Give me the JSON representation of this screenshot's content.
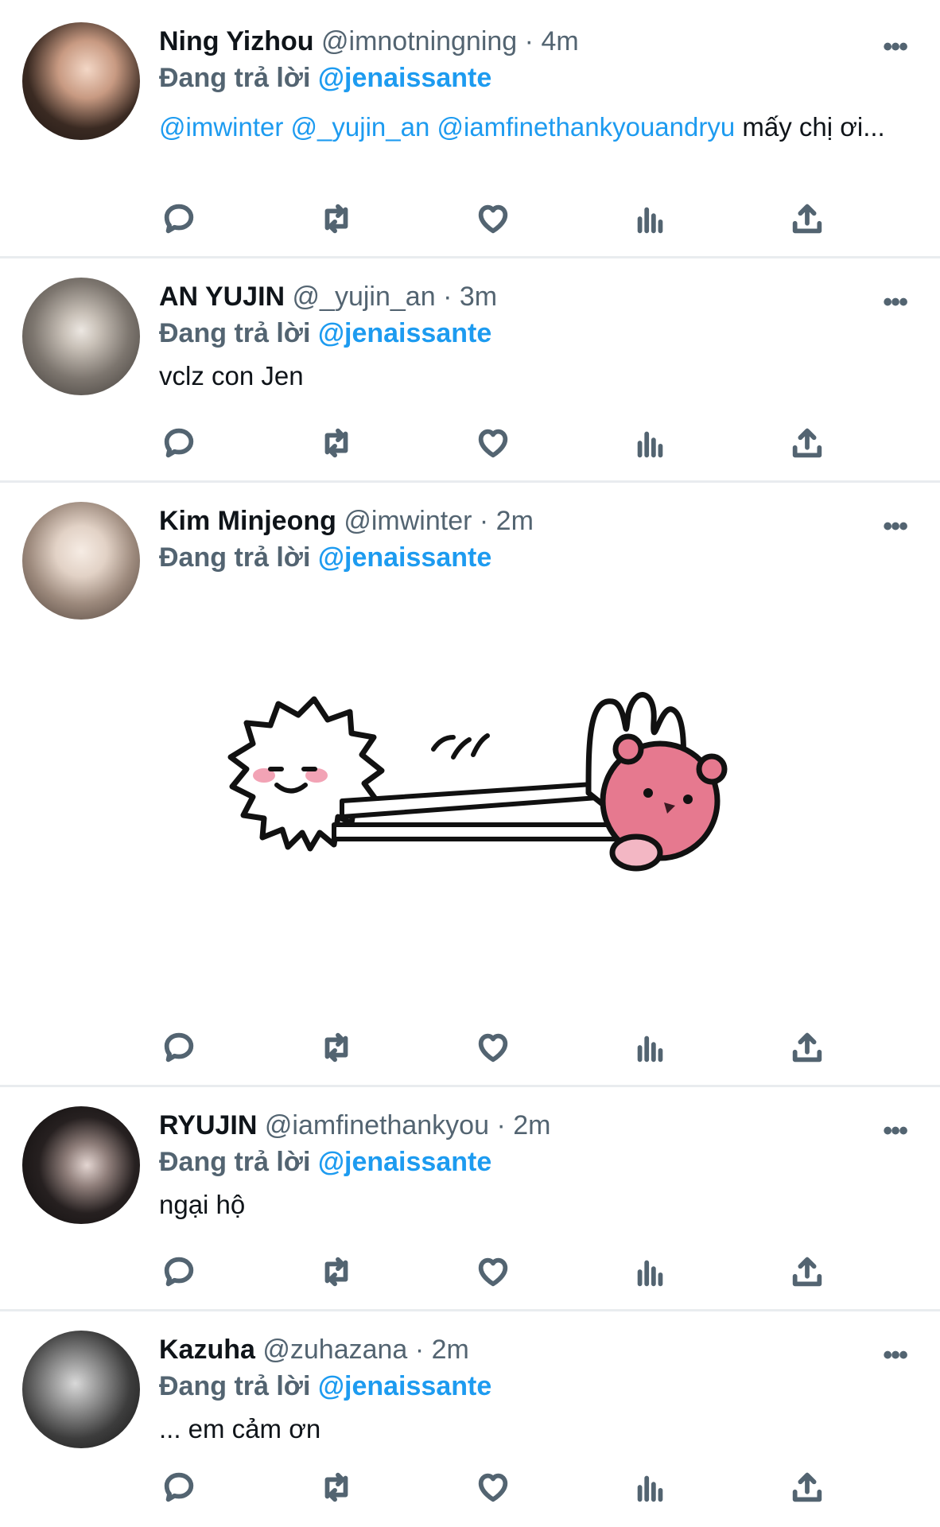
{
  "tweets": [
    {
      "name": "Ning Yizhou",
      "handle": "@imnotningning",
      "time": "4m",
      "reply_prefix": "Đang trả lời",
      "reply_to": "@jenaissante",
      "mentions": [
        "@imwinter",
        "@_yujin_an",
        "@iamfinethankyouandryu"
      ],
      "text": "mấy chị ơi..."
    },
    {
      "name": "AN YUJIN",
      "handle": "@_yujin_an",
      "time": "3m",
      "reply_prefix": "Đang trả lời",
      "reply_to": "@jenaissante",
      "text": "vclz con Jen"
    },
    {
      "name": "Kim Minjeong",
      "handle": "@imwinter",
      "time": "2m",
      "reply_prefix": "Đang trả lời",
      "reply_to": "@jenaissante",
      "text": ""
    },
    {
      "name": "RYUJIN",
      "handle": "@iamfinethankyou",
      "time": "2m",
      "reply_prefix": "Đang trả lời",
      "reply_to": "@jenaissante",
      "text": "ngại hộ"
    },
    {
      "name": "Kazuha",
      "handle": "@zuhazana",
      "time": "2m",
      "reply_prefix": "Đang trả lời",
      "reply_to": "@jenaissante",
      "text": "... em cảm ơn"
    }
  ],
  "separator": "·",
  "more_label": "•••",
  "colors": {
    "accent": "#1d9bf0",
    "muted": "#536471",
    "text": "#0f1419"
  }
}
